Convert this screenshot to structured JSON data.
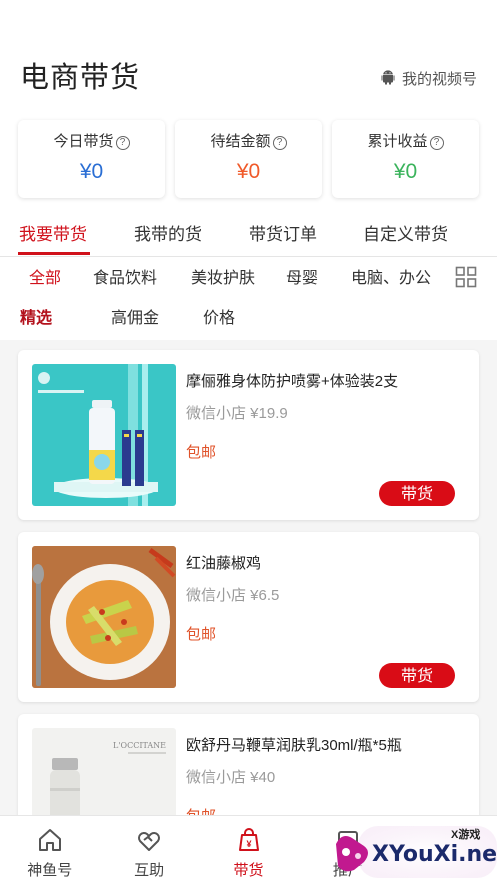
{
  "header": {
    "title": "电商带货",
    "my_video_label": "我的视频号"
  },
  "stats": [
    {
      "label": "今日带货",
      "value": "¥0",
      "color": "#2a6ed4"
    },
    {
      "label": "待结金额",
      "value": "¥0",
      "color": "#f05a2a"
    },
    {
      "label": "累计收益",
      "value": "¥0",
      "color": "#3bb35c"
    }
  ],
  "main_tabs": [
    "我要带货",
    "我带的货",
    "带货订单",
    "自定义带货"
  ],
  "active_main_tab": "我要带货",
  "categories": [
    "全部",
    "食品饮料",
    "美妆护肤",
    "母婴",
    "电脑、办公"
  ],
  "active_category": "全部",
  "sorts": [
    "精选",
    "高佣金",
    "价格"
  ],
  "active_sort": "精选",
  "products": [
    {
      "name": "摩俪雅身体防护喷雾+体验装2支",
      "price": "微信小店 ¥19.9",
      "shipping": "包邮",
      "button": "带货"
    },
    {
      "name": "红油藤椒鸡",
      "price": "微信小店 ¥6.5",
      "shipping": "包邮",
      "button": "带货"
    },
    {
      "name": "欧舒丹马鞭草润肤乳30ml/瓶*5瓶",
      "price": "微信小店 ¥40",
      "shipping": "包邮",
      "button": "带货",
      "image_brand_text": "L'OCCITANE"
    }
  ],
  "bottom_nav": [
    "神鱼号",
    "互助",
    "带货",
    "推广"
  ],
  "active_nav": "带货",
  "watermark": {
    "text": "XYouXi.net",
    "small": "X游戏"
  },
  "colors": {
    "accent": "#d0111b",
    "button": "#d90c16",
    "shipping": "#e0532a"
  }
}
